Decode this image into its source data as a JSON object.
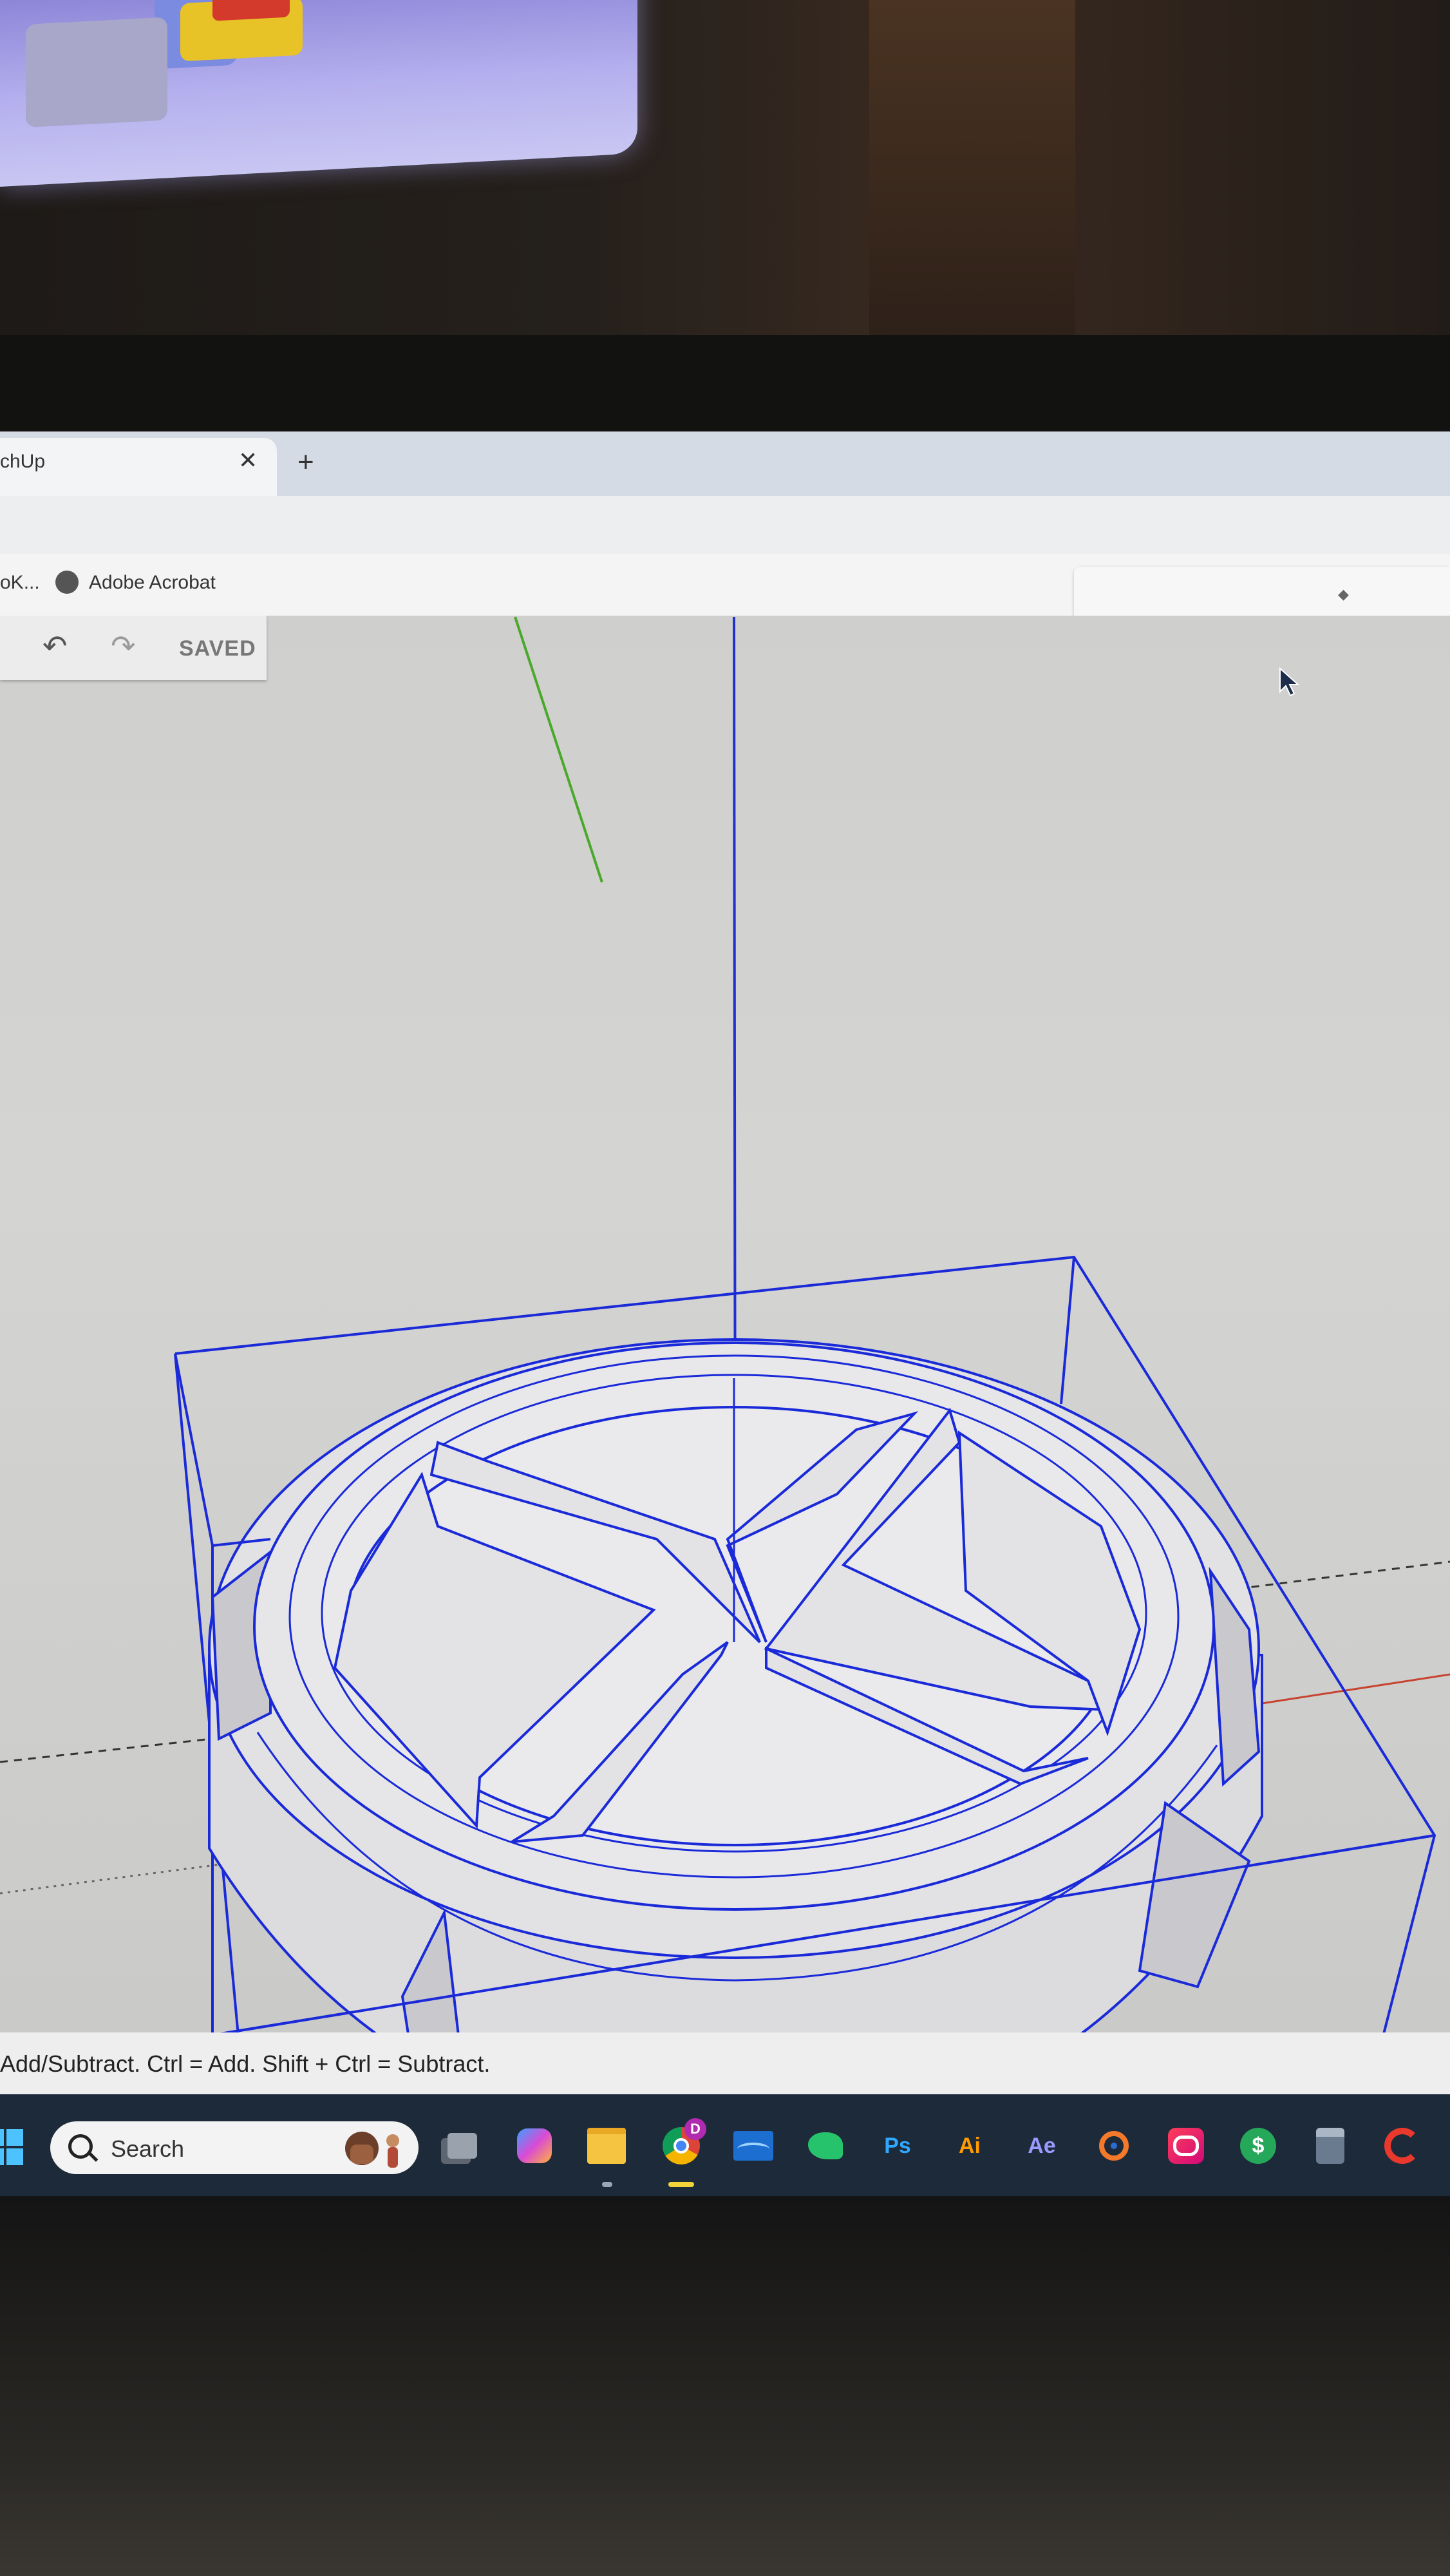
{
  "browser": {
    "tab_title": "chUp",
    "tab_close": "✕",
    "new_tab": "+",
    "bookmarks": [
      {
        "label": "oK..."
      },
      {
        "label": "Adobe Acrobat",
        "icon": "globe-icon"
      }
    ]
  },
  "sketchup_toolbar": {
    "undo_icon": "↶",
    "redo_icon": "↷",
    "saved_label": "SAVED"
  },
  "status_bar": {
    "hint": "Add/Subtract. Ctrl = Add. Shift + Ctrl = Subtract."
  },
  "taskbar": {
    "search_label": "Search",
    "apps": [
      {
        "name": "task-view",
        "label": ""
      },
      {
        "name": "copilot",
        "label": ""
      },
      {
        "name": "file-explorer",
        "label": ""
      },
      {
        "name": "chrome",
        "label": "",
        "badge": "D"
      },
      {
        "name": "media",
        "label": ""
      },
      {
        "name": "drawing",
        "label": ""
      },
      {
        "name": "photoshop",
        "label": "Ps"
      },
      {
        "name": "illustrator",
        "label": "Ai"
      },
      {
        "name": "after-effects",
        "label": "Ae"
      },
      {
        "name": "blender",
        "label": ""
      },
      {
        "name": "creative-cloud",
        "label": ""
      },
      {
        "name": "money-app",
        "label": "$"
      },
      {
        "name": "calculator",
        "label": ""
      },
      {
        "name": "ccleaner",
        "label": ""
      }
    ]
  },
  "colors": {
    "selection_blue": "#1a2ad8",
    "axis_green": "#4aa82a",
    "axis_red": "#c8432f",
    "taskbar_bg": "#1d2a3a"
  }
}
